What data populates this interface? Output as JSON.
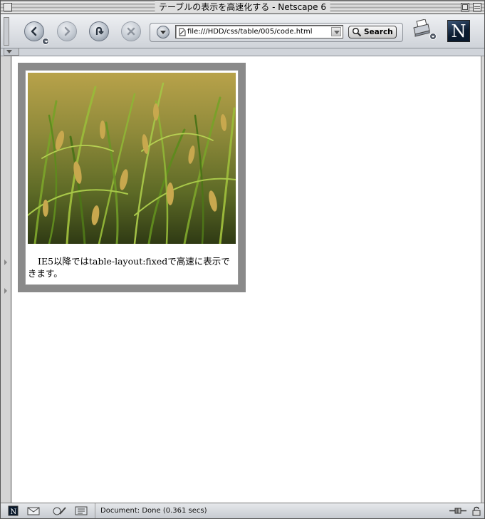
{
  "window": {
    "title": "テーブルの表示を高速化する - Netscape 6"
  },
  "toolbar": {
    "back": "back-icon",
    "forward": "forward-icon",
    "reload": "reload-icon",
    "stop": "stop-icon",
    "url_value": "file:///HDD/css/table/005/code.html",
    "search_label": "Search",
    "print": "print-icon",
    "logo_letter": "N"
  },
  "content": {
    "photo_description": "rice-field-photo",
    "caption": "IE5以降ではtable-layout:fixedで高速に表示できます。"
  },
  "statusbar": {
    "status": "Document: Done (0.361 secs)"
  }
}
